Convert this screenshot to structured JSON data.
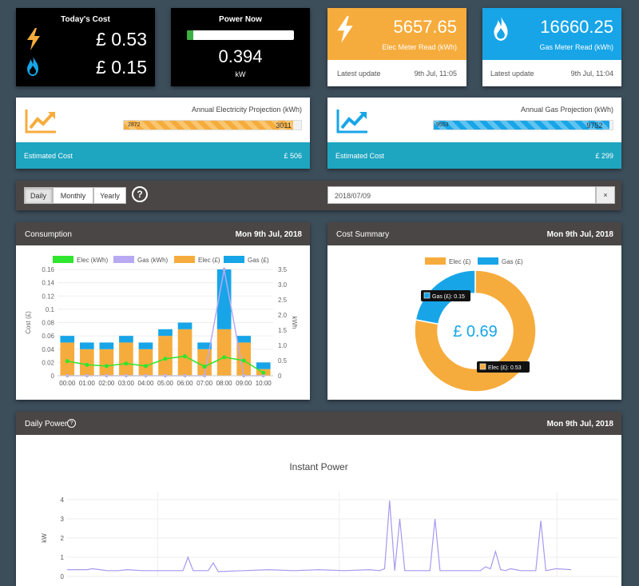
{
  "todays_cost": {
    "title": "Today's Cost",
    "elec_value": "£ 0.53",
    "gas_value": "£ 0.15"
  },
  "power_now": {
    "title": "Power Now",
    "value": "0.394",
    "unit": "kW",
    "level_fraction": 0.06
  },
  "elec_meter": {
    "value": "5657.65",
    "label": "Elec Meter Read (kWh)",
    "update_label": "Latest update",
    "update_time": "9th Jul, 11:05"
  },
  "gas_meter": {
    "value": "16660.25",
    "label": "Gas Meter Read (kWh)",
    "update_label": "Latest update",
    "update_time": "9th Jul, 11:04"
  },
  "elec_projection": {
    "title": "Annual Electricity Projection (kWh)",
    "current": "2872",
    "projected": "3011",
    "fraction": 0.954,
    "cost_label": "Estimated Cost",
    "cost_value": "£ 506"
  },
  "gas_projection": {
    "title": "Annual Gas Projection (kWh)",
    "current": "9553",
    "projected": "9752",
    "fraction": 0.98,
    "cost_label": "Estimated Cost",
    "cost_value": "£ 299"
  },
  "toolbar": {
    "daily": "Daily",
    "monthly": "Monthly",
    "yearly": "Yearly",
    "help": "?",
    "date_value": "2018/07/09",
    "clear": "×"
  },
  "consumption": {
    "title": "Consumption",
    "date": "Mon 9th Jul, 2018"
  },
  "cost_summary": {
    "title": "Cost Summary",
    "date": "Mon 9th Jul, 2018"
  },
  "daily_power": {
    "title": "Daily Power",
    "help": "?",
    "date": "Mon 9th Jul, 2018"
  },
  "colors": {
    "elec": "#f6ac3c",
    "gas": "#17a5e8",
    "elec_line": "#2ee62e",
    "gas_line": "#b9a9f2",
    "power_line": "#a898f0"
  },
  "chart_data": [
    {
      "type": "bar",
      "categories": [
        "00:00",
        "01:00",
        "02:00",
        "03:00",
        "04:00",
        "05:00",
        "06:00",
        "07:00",
        "08:00",
        "09:00",
        "10:00"
      ],
      "series": [
        {
          "name": "Elec (kWh)",
          "kind": "line",
          "axis": "right",
          "values": [
            0.48,
            0.36,
            0.32,
            0.4,
            0.32,
            0.56,
            0.64,
            0.3,
            0.61,
            0.5,
            0.1
          ]
        },
        {
          "name": "Gas (kWh)",
          "kind": "line",
          "axis": "right",
          "values": [
            0,
            0,
            0,
            0,
            0,
            0,
            0,
            0,
            3.5,
            0,
            0
          ]
        },
        {
          "name": "Elec (£)",
          "kind": "bar",
          "axis": "left",
          "values": [
            0.05,
            0.04,
            0.04,
            0.05,
            0.04,
            0.06,
            0.07,
            0.04,
            0.07,
            0.05,
            0.01
          ]
        },
        {
          "name": "Gas (£)",
          "kind": "bar",
          "axis": "left",
          "values": [
            0.01,
            0.01,
            0.01,
            0.01,
            0.01,
            0.01,
            0.01,
            0.01,
            0.09,
            0.01,
            0.01
          ]
        }
      ],
      "ylabel": "Cost (£)",
      "y2label": "kWh",
      "ylim": [
        0,
        0.16
      ],
      "y2lim": [
        0,
        3.5
      ],
      "yticks": [
        "0",
        "0.02",
        "0.04",
        "0.06",
        "0.08",
        "0.1",
        "0.12",
        "0.14",
        "0.16"
      ],
      "y2ticks": [
        "0",
        "0.5",
        "1.0",
        "1.5",
        "2.0",
        "2.5",
        "3.0",
        "3.5"
      ],
      "legend": "top"
    },
    {
      "type": "pie",
      "labels": [
        "Elec (£)",
        "Gas (£)"
      ],
      "values": [
        0.53,
        0.15
      ],
      "center_text": "£ 0.69",
      "tooltip_elec": "Elec (£): 0.53",
      "tooltip_gas": "Gas (£): 0.15",
      "legend": "top"
    },
    {
      "type": "line",
      "title": "Instant Power",
      "ylabel": "kW",
      "ylim": [
        0,
        4
      ],
      "yticks": [
        "0",
        "1",
        "2",
        "3",
        "4"
      ],
      "x": [
        0,
        0.04,
        0.05,
        0.08,
        0.1,
        0.12,
        0.15,
        0.2,
        0.23,
        0.24,
        0.25,
        0.28,
        0.29,
        0.3,
        0.35,
        0.4,
        0.45,
        0.5,
        0.55,
        0.6,
        0.62,
        0.63,
        0.64,
        0.65,
        0.66,
        0.67,
        0.7,
        0.72,
        0.73,
        0.74,
        0.75,
        0.8,
        0.82,
        0.83,
        0.84,
        0.85,
        0.86,
        0.87,
        0.88,
        0.89,
        0.9,
        0.93,
        0.94,
        0.95,
        0.97,
        1.0
      ],
      "values": [
        0.35,
        0.35,
        0.4,
        0.3,
        0.3,
        0.35,
        0.3,
        0.3,
        0.3,
        1.0,
        0.3,
        0.3,
        0.7,
        0.25,
        0.3,
        0.35,
        0.3,
        0.35,
        0.3,
        0.35,
        0.3,
        0.4,
        3.95,
        0.3,
        3.0,
        0.3,
        0.3,
        0.3,
        3.0,
        0.3,
        0.3,
        0.3,
        0.3,
        0.5,
        0.4,
        1.3,
        0.35,
        0.3,
        0.4,
        0.35,
        0.3,
        0.3,
        2.9,
        0.3,
        0.4,
        0.35
      ]
    }
  ]
}
